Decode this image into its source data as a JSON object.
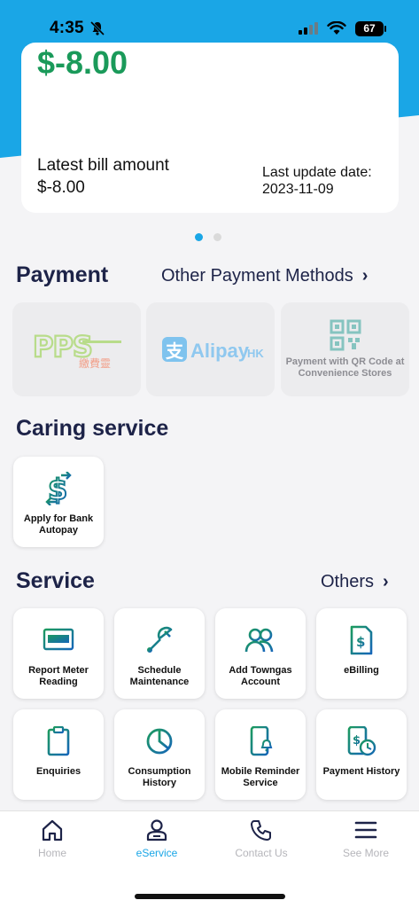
{
  "status": {
    "time": "4:35",
    "battery": "67"
  },
  "bill": {
    "big_amount": "$-8.00",
    "latest_label": "Latest bill amount",
    "latest_amount": "$-8.00",
    "update_label": "Last update date:",
    "update_date": "2023-11-09",
    "page_count": 2,
    "active_page": 1
  },
  "payment": {
    "title": "Payment",
    "other_link": "Other Payment Methods",
    "tiles": [
      {
        "name": "pps-logo",
        "text": "PPS",
        "subtext": "繳費靈"
      },
      {
        "name": "alipayhk-logo",
        "text": "Alipay",
        "subtext": "HK"
      },
      {
        "name": "qr-code",
        "text": "Payment with QR Code at Convenience Stores"
      }
    ]
  },
  "caring": {
    "title": "Caring service",
    "items": [
      {
        "label": "Apply for Bank Autopay",
        "icon": "bank-autopay-icon"
      }
    ]
  },
  "service": {
    "title": "Service",
    "other_link": "Others",
    "items": [
      {
        "label": "Report Meter Reading",
        "icon": "meter-icon"
      },
      {
        "label": "Schedule Maintenance",
        "icon": "wrench-icon"
      },
      {
        "label": "Add Towngas Account",
        "icon": "users-icon"
      },
      {
        "label": "eBilling",
        "icon": "ebill-icon"
      },
      {
        "label": "Enquiries",
        "icon": "clipboard-icon"
      },
      {
        "label": "Consumption History",
        "icon": "pie-chart-icon"
      },
      {
        "label": "Mobile Reminder Service",
        "icon": "phone-bell-icon"
      },
      {
        "label": "Payment History",
        "icon": "bill-clock-icon"
      }
    ]
  },
  "nav": {
    "items": [
      {
        "label": "Home",
        "icon": "home-icon"
      },
      {
        "label": "eService",
        "icon": "person-icon",
        "active": true
      },
      {
        "label": "Contact Us",
        "icon": "phone-icon"
      },
      {
        "label": "See More",
        "icon": "menu-icon"
      }
    ]
  },
  "colors": {
    "accent": "#1aa6e6",
    "amount": "#1a9a5a",
    "heading": "#1d2348",
    "icon_gradient": [
      "#1c9a5f",
      "#1566b8"
    ]
  }
}
